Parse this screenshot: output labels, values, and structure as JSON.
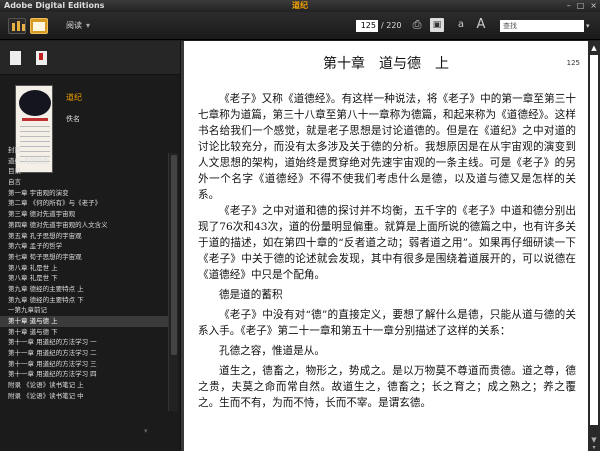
{
  "window": {
    "app_title": "Adobe Digital Editions",
    "doc_title": "道纪"
  },
  "toolbar": {
    "view_mode": "阅读",
    "page_current": "125",
    "page_total": "/ 220",
    "search_placeholder": "查找"
  },
  "sidebar": {
    "book_title": "道纪",
    "book_author": "佚名",
    "toc": [
      "封面",
      "道纪 内容简要",
      "目录",
      "自言",
      "第一章 宇宙观的演变",
      "第二章 《何的所有》与《老子》",
      "第三章 德对先道宇宙观",
      "第四章 德对先道宇宙观的人文含义",
      "第五章 孔子思想的宇宙观",
      "第六章 孟子的哲学",
      "第七章 荀子思想的宇宙观",
      "第八章 礼是世 上",
      "第八章 礼是世 下",
      "第九章 德经的主要特点 上",
      "第九章 德经的主要特点 下",
      "一第九章前记",
      "第十章 道与德 上",
      "第十章 道与德 下",
      "第十一章 用道纪的方法学习 一",
      "第十一章 用道纪的方法学习 二",
      "第十一章 用道纪的方法学习 三",
      "第十一章 用道纪的方法学习 四",
      "附录 《论语》读书笔记 上",
      "附录 《论语》读书笔记 中"
    ],
    "selected_index": 16
  },
  "page": {
    "page_number": "125",
    "chapter_title": "第十章　道与德　上",
    "paragraphs": [
      "《老子》又称《道德经》。有这样一种说法，将《老子》中的第一章至第三十七章称为道篇，第三十八章至第八十一章称为德篇，和起来称为《道德经》。这样书名给我们一个感觉，就是老子思想是讨论道德的。但是在《道纪》之中对道的讨论比较充分，而没有太多涉及关于德的分析。我想原因是在从宇宙观的演变到人文思想的架构，道始终是贯穿绝对先速宇宙观的一条主线。可是《老子》的另外一个名字《道德经》不得不使我们考虑什么是德，以及道与德又是怎样的关系。",
      "《老子》之中对道和德的探讨并不均衡，五千字的《老子》中道和德分别出现了76次和43次，道的份量明显偏重。就算是上面所说的德篇之中，也有许多关于道的描述，如在第四十章的“反者道之动；弱者道之用”。如果再仔细研读一下《老子》中关于德的论述就会发现，其中有很多是围绕着道展开的，可以说德在《道德经》中只是个配角。",
      "德是道的蓄积",
      "《老子》中没有对“德”的直接定义，要想了解什么是德，只能从道与德的关系入手。《老子》第二十一章和第五十一章分别描述了这样的关系：",
      "孔德之容，惟道是从。",
      "道生之，德畜之，物形之，势成之。是以万物莫不尊道而贵德。道之尊，德之贵，夫莫之命而常自然。故道生之，德畜之；长之育之；成之熟之；养之覆之。生而不有，为而不恃，长而不宰。是谓玄德。"
    ]
  },
  "colors": {
    "accent": "#f0a000",
    "toolbar_bg": "#222222",
    "page_bg": "#ffffff"
  },
  "icons": [
    "library-icon",
    "reading-view-icon",
    "print-icon",
    "bookmark-icon",
    "font-smaller-icon",
    "font-larger-icon"
  ]
}
